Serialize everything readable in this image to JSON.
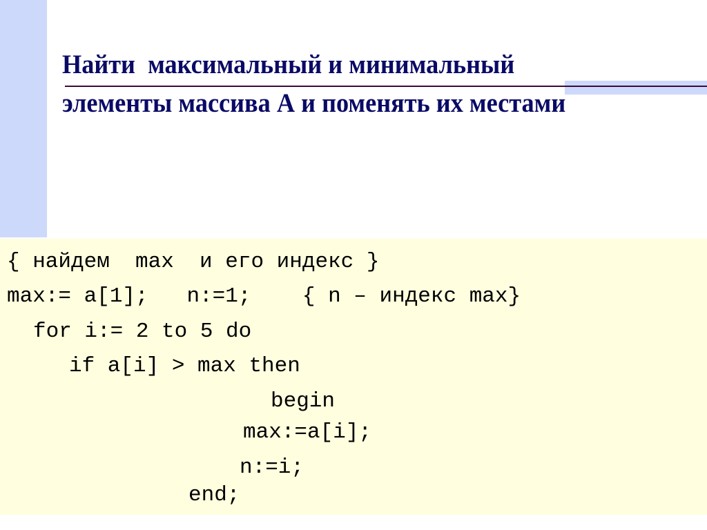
{
  "slide": {
    "title_lines": [
      "Найти  максимальный и минимальный",
      "элементы массива А и поменять их местами"
    ],
    "code_lines": [
      "{ найдем  max  и его индекс }",
      "max:= a[1];   n:=1;    { n – индекс max}",
      "for i:= 2 to 5 do",
      "if a[i] > max then",
      "begin",
      "max:=a[i];",
      "n:=i;",
      "end;"
    ]
  },
  "colors": {
    "title": "#0a0a66",
    "accent_blue": "#cdd9fb",
    "code_background": "#ffffdf",
    "rule": "#3a0a3a"
  }
}
